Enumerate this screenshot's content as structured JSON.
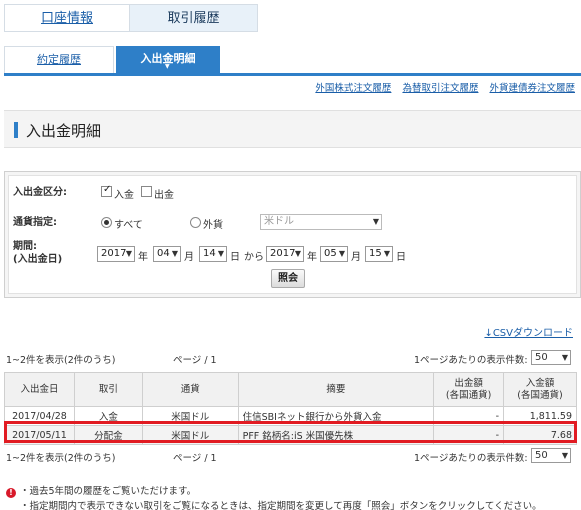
{
  "top_tabs": [
    "口座情報",
    "取引履歴"
  ],
  "sub_tabs": [
    "約定履歴",
    "入出金明細"
  ],
  "links": [
    "外国株式注文履歴",
    "為替取引注文履歴",
    "外貨建債券注文履歴"
  ],
  "page_title": "入出金明細",
  "filter": {
    "type_label": "入出金区分:",
    "type_options": [
      "入金",
      "出金"
    ],
    "type_checked": [
      true,
      false
    ],
    "currency_label": "通貨指定:",
    "currency_options": [
      "すべて",
      "外貨"
    ],
    "currency_selected": "すべて",
    "currency_select": "米ドル",
    "period_label_1": "期間:",
    "period_label_2": "(入出金日)",
    "from": {
      "year": "2017",
      "month": "04",
      "day": "14"
    },
    "to": {
      "year": "2017",
      "month": "05",
      "day": "15"
    },
    "unit_year": "年",
    "unit_month": "月",
    "unit_day": "日",
    "kara": "から",
    "search_button": "照会"
  },
  "csv_link": "↓CSVダウンロード",
  "count_text": "1~2件を表示(2件のうち)",
  "page_text": "ページ / 1",
  "per_page_label": "1ページあたりの表示件数:",
  "per_page_value": "50",
  "table": {
    "headers": [
      "入出金日",
      "取引",
      "通貨",
      "摘要",
      "出金額\n(各国通貨)",
      "入金額\n(各国通貨)"
    ],
    "rows": [
      [
        "2017/04/28",
        "入金",
        "米国ドル",
        "住信SBIネット銀行から外貨入金",
        "-",
        "1,811.59"
      ],
      [
        "2017/05/11",
        "分配金",
        "米国ドル",
        "PFF 銘柄名:iS 米国優先株",
        "-",
        "7.68"
      ]
    ]
  },
  "notes": [
    "・過去5年間の履歴をご覧いただけます。",
    "・指定期間内で表示できない取引をご覧になるときは、指定期間を変更して再度「照会」ボタンをクリックしてください。"
  ]
}
